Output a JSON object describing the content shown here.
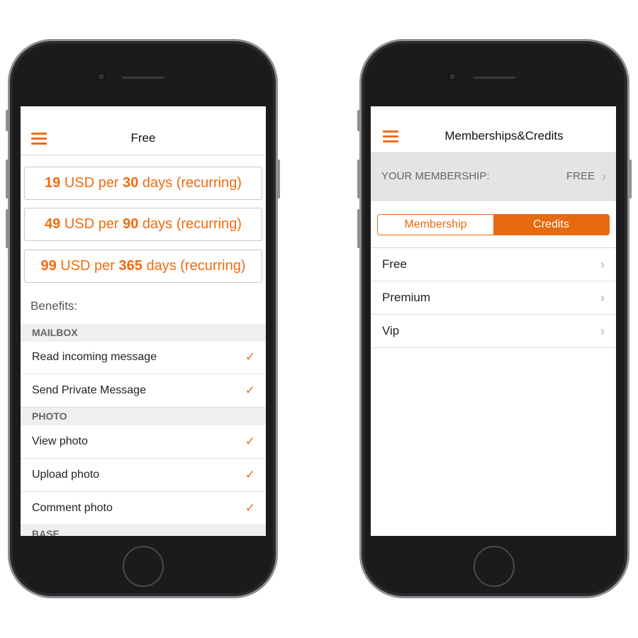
{
  "left_phone": {
    "header": {
      "title": "Free",
      "menu_icon": "hamburger-icon"
    },
    "plans": [
      {
        "price": "19",
        "text1": " USD per ",
        "days": "30",
        "text2": " days (recurring)"
      },
      {
        "price": "49",
        "text1": " USD per ",
        "days": "90",
        "text2": " days (recurring)"
      },
      {
        "price": "99",
        "text1": " USD per ",
        "days": "365",
        "text2": " days (recurring)"
      }
    ],
    "benefits_label": "Benefits:",
    "sections": [
      {
        "title": "MAILBOX",
        "items": [
          "Read incoming message",
          "Send Private Message"
        ]
      },
      {
        "title": "PHOTO",
        "items": [
          "View photo",
          "Upload photo",
          "Comment photo"
        ]
      },
      {
        "title": "BASE",
        "items": []
      }
    ],
    "check_glyph": "✓"
  },
  "right_phone": {
    "header": {
      "title": "Memberships&Credits",
      "menu_icon": "hamburger-icon"
    },
    "membership": {
      "label": "YOUR MEMBERSHIP:",
      "value": "FREE"
    },
    "segments": {
      "membership": "Membership",
      "credits": "Credits",
      "selected": "Credits"
    },
    "rows": [
      "Free",
      "Premium",
      "Vip"
    ]
  },
  "colors": {
    "accent": "#f26b0f",
    "segment": "#e86a10"
  }
}
